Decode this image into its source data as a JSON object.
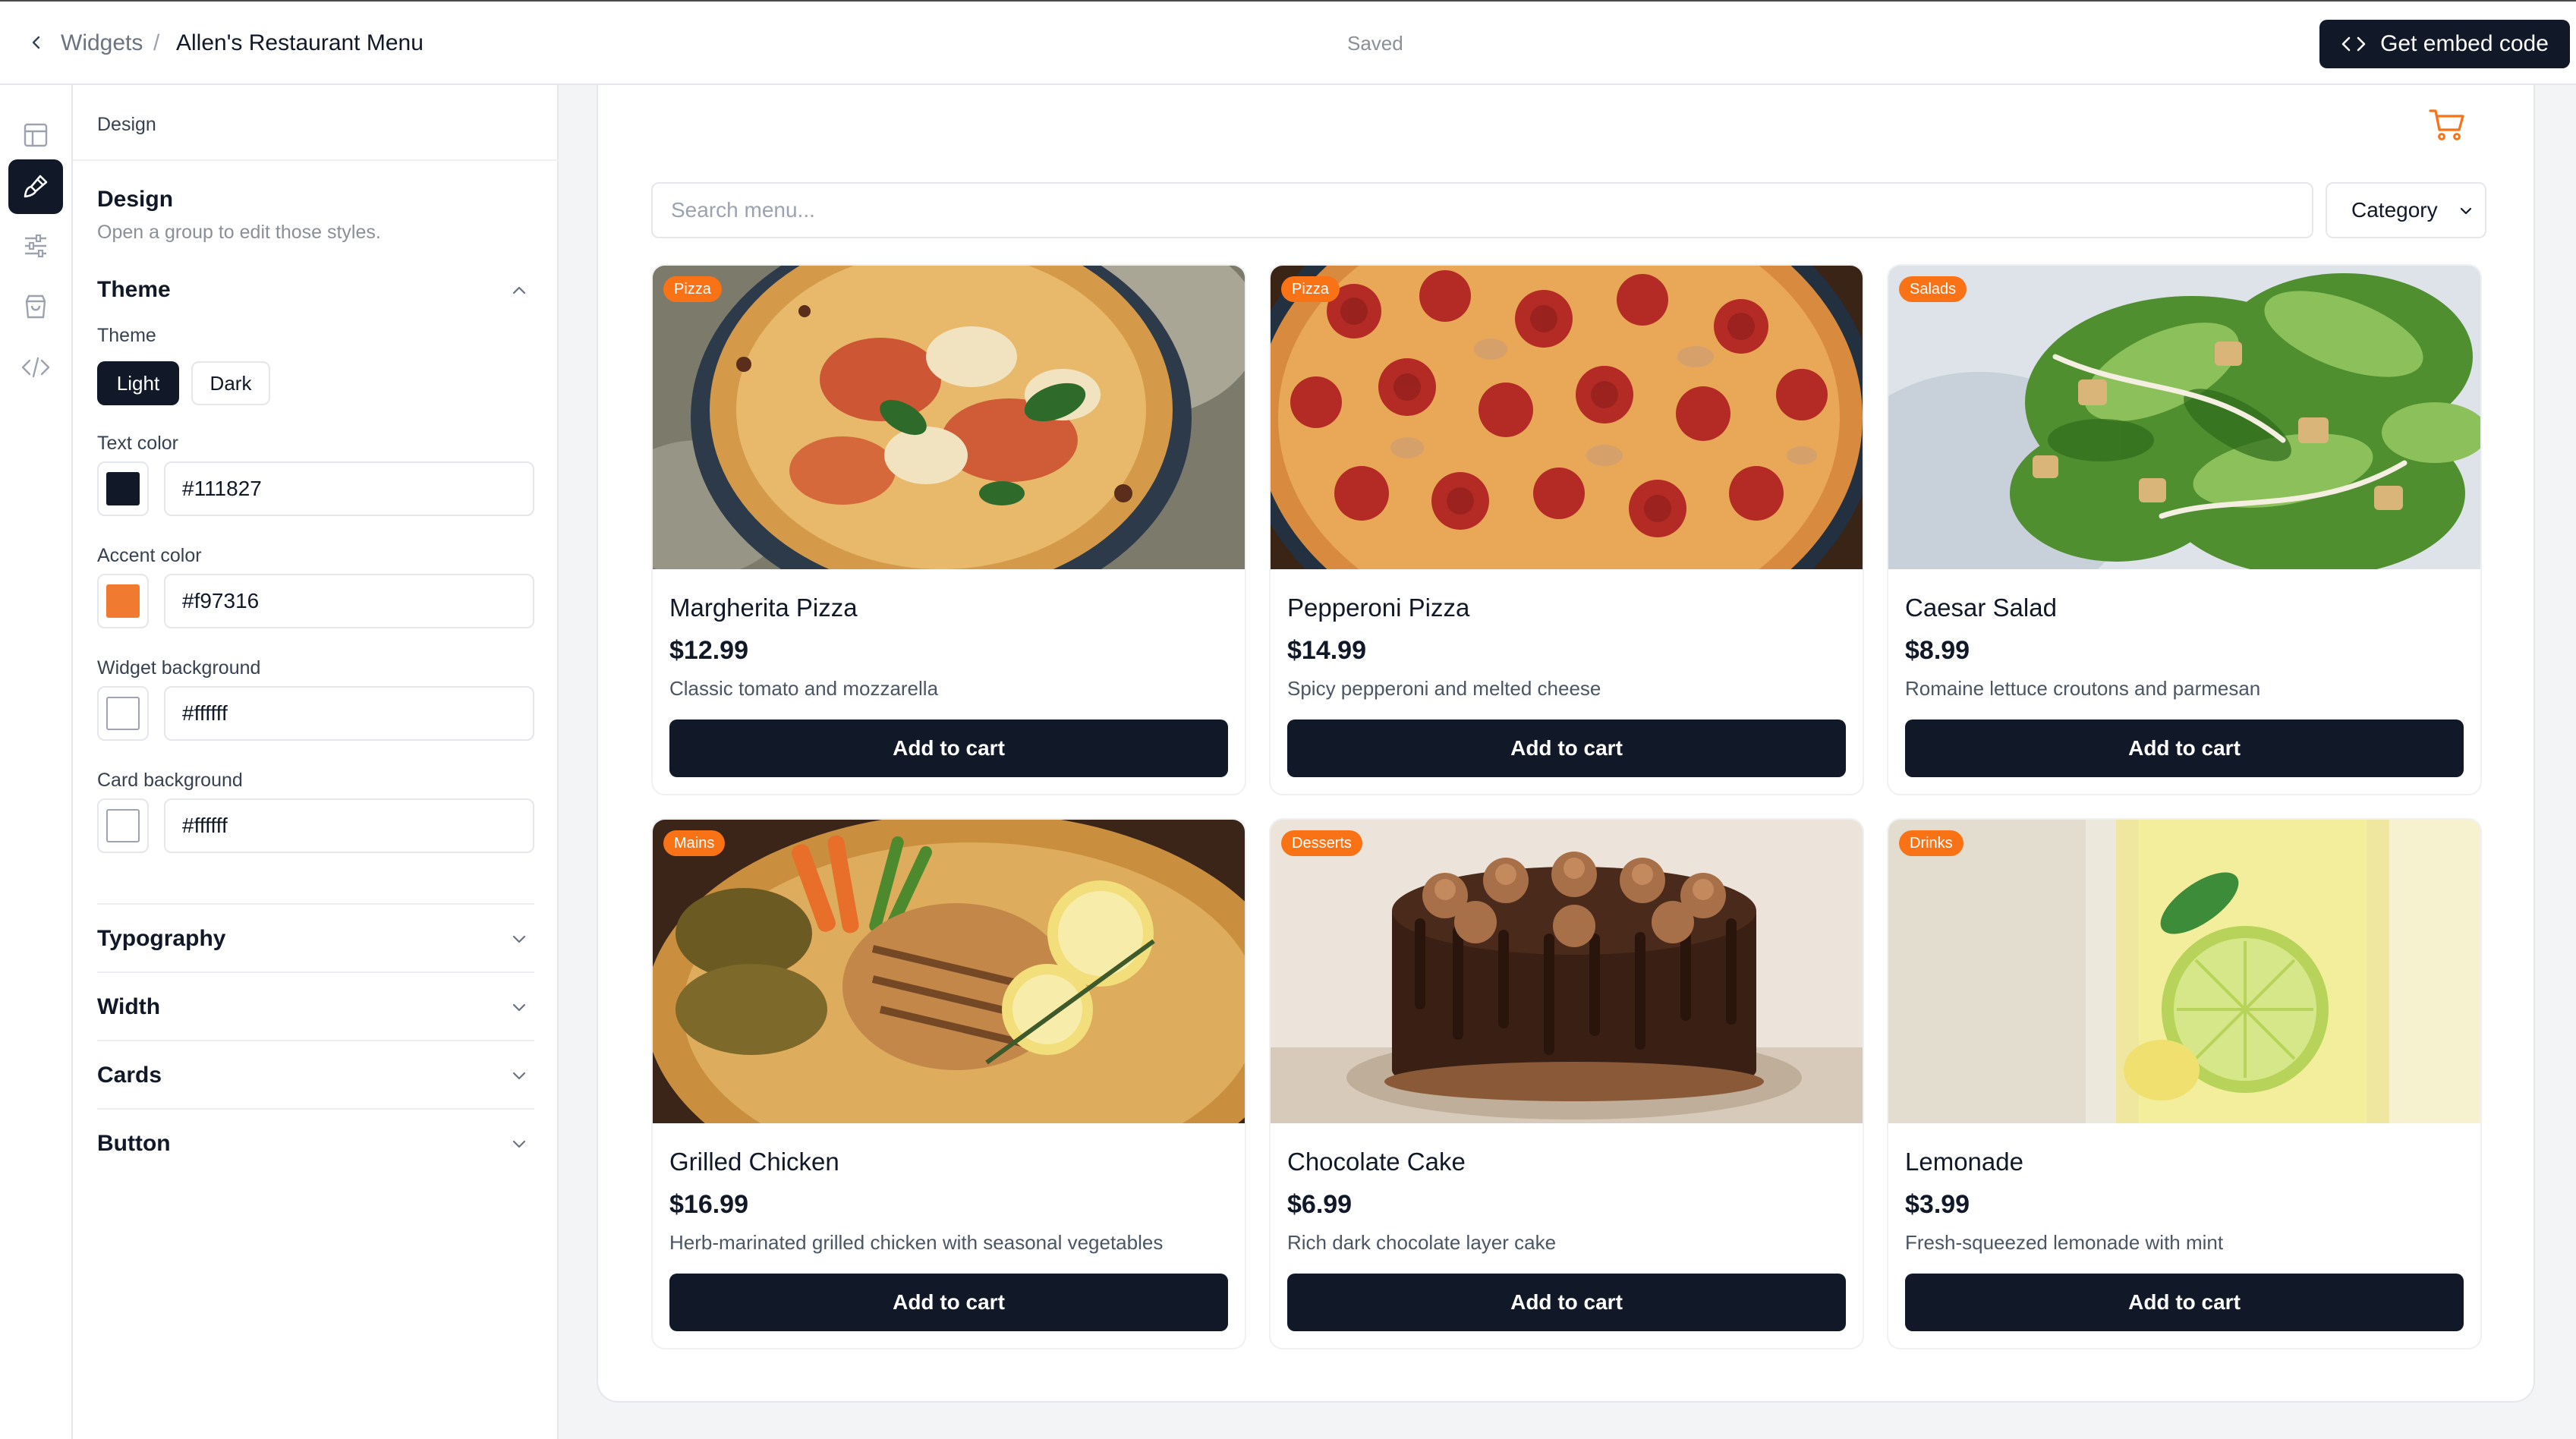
{
  "topbar": {
    "breadcrumb_root": "Widgets",
    "breadcrumb_sep": "/",
    "breadcrumb_current": "Allen's Restaurant Menu",
    "status": "Saved",
    "embed_label": "Get embed code"
  },
  "rail": {
    "items": [
      {
        "icon": "layout-icon",
        "active": false
      },
      {
        "icon": "paintbrush-icon",
        "active": true
      },
      {
        "icon": "sliders-icon",
        "active": false
      },
      {
        "icon": "shopping-bag-icon",
        "active": false
      },
      {
        "icon": "code-icon",
        "active": false
      }
    ]
  },
  "panel": {
    "header": "Design",
    "section_title": "Design",
    "section_subtitle": "Open a group to edit those styles.",
    "theme": {
      "title": "Theme",
      "label": "Theme",
      "options": [
        "Light",
        "Dark"
      ],
      "selected": "Light"
    },
    "colors": [
      {
        "label": "Text color",
        "value": "#111827"
      },
      {
        "label": "Accent color",
        "value": "#f97316"
      },
      {
        "label": "Widget background",
        "value": "#ffffff"
      },
      {
        "label": "Card background",
        "value": "#ffffff"
      }
    ],
    "groups": [
      "Typography",
      "Width",
      "Cards",
      "Button"
    ]
  },
  "widget": {
    "accent_color": "#f97316",
    "search_placeholder": "Search menu...",
    "category_label": "Category",
    "add_label": "Add to cart",
    "items": [
      {
        "badge": "Pizza",
        "name": "Margherita Pizza",
        "price": "$12.99",
        "desc": "Classic tomato and mozzarella"
      },
      {
        "badge": "Pizza",
        "name": "Pepperoni Pizza",
        "price": "$14.99",
        "desc": "Spicy pepperoni and melted cheese"
      },
      {
        "badge": "Salads",
        "name": "Caesar Salad",
        "price": "$8.99",
        "desc": "Romaine lettuce croutons and parmesan"
      },
      {
        "badge": "Mains",
        "name": "Grilled Chicken",
        "price": "$16.99",
        "desc": "Herb-marinated grilled chicken with seasonal vegetables"
      },
      {
        "badge": "Desserts",
        "name": "Chocolate Cake",
        "price": "$6.99",
        "desc": "Rich dark chocolate layer cake"
      },
      {
        "badge": "Drinks",
        "name": "Lemonade",
        "price": "$3.99",
        "desc": "Fresh-squeezed lemonade with mint"
      }
    ]
  }
}
